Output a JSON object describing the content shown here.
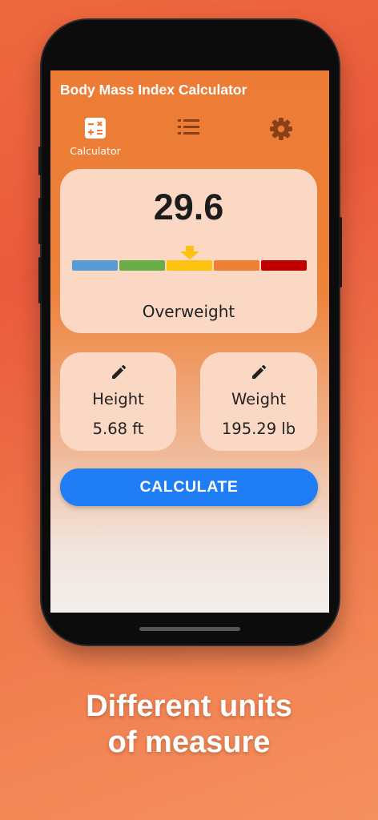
{
  "app": {
    "title": "Body Mass Index Calculator"
  },
  "tabs": [
    {
      "label": "Calculator",
      "icon": "calculator-icon",
      "selected": true
    },
    {
      "label": "",
      "icon": "list-icon",
      "selected": false
    },
    {
      "label": "",
      "icon": "gear-icon",
      "selected": false
    }
  ],
  "bmi": {
    "value": "29.6",
    "category": "Overweight",
    "scale_colors": [
      "#5b9bd5",
      "#6aac45",
      "#fdc210",
      "#ef7f34",
      "#c00000"
    ],
    "pointer_segment": 2,
    "pointer_color": "#fdc210"
  },
  "height": {
    "label": "Height",
    "value": "5.68 ft",
    "icon": "pencil-icon"
  },
  "weight": {
    "label": "Weight",
    "value": "195.29 lb",
    "icon": "pencil-icon"
  },
  "calculate": {
    "label": "CALCULATE",
    "color": "#1f7ef5"
  },
  "caption": {
    "line1": "Different units",
    "line2": "of measure"
  },
  "colors": {
    "primary": "#ec7b35",
    "card": "#fad8c4",
    "icon_dark": "#8b3f17"
  }
}
